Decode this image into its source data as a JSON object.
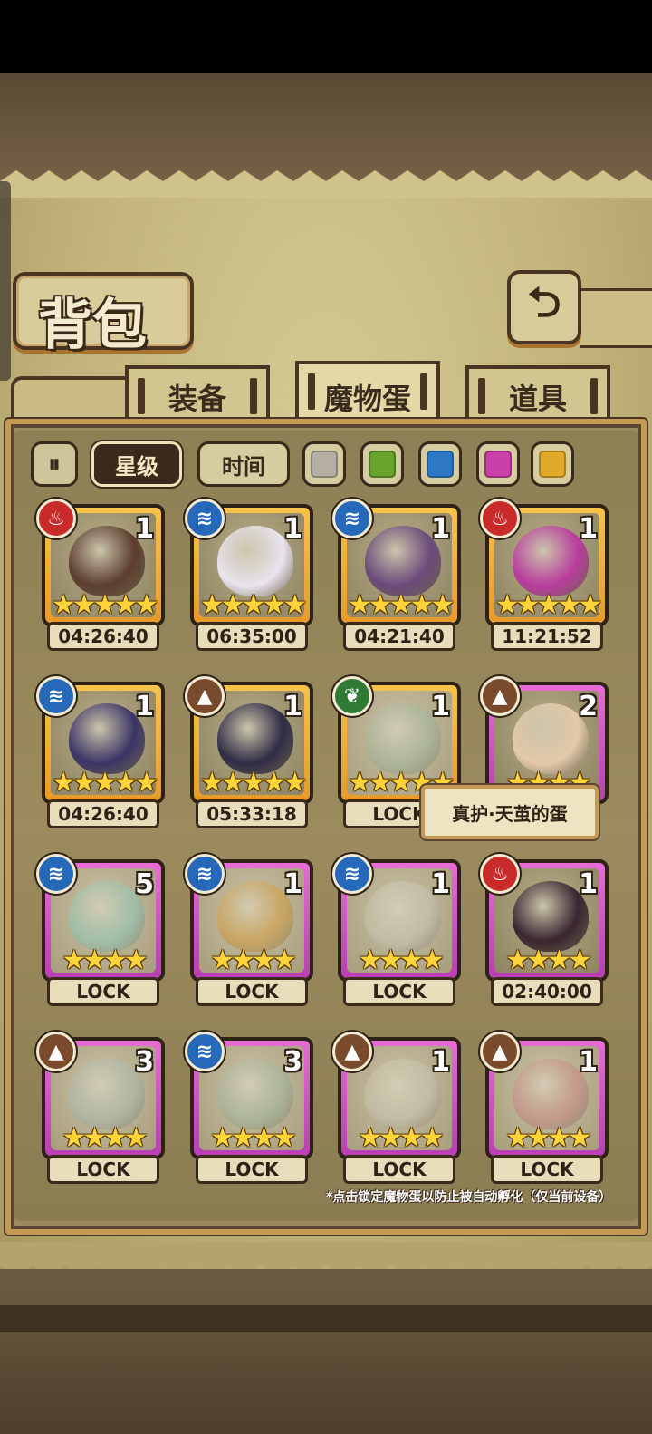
{
  "header": {
    "title": "背包",
    "back_icon": "return-icon"
  },
  "tabs": [
    {
      "label": "装备",
      "active": false
    },
    {
      "label": "魔物蛋",
      "active": true
    },
    {
      "label": "道具",
      "active": false
    }
  ],
  "filters": {
    "sort_icon": "pause-sort-icon",
    "star_label": "星级",
    "time_label": "时间",
    "swatches": [
      "#b5aea2",
      "#6aa22e",
      "#2f78c4",
      "#c840a8",
      "#e0a92a"
    ]
  },
  "eggs": [
    {
      "element": "fire",
      "count": "1",
      "stars": "★★★★★",
      "label": "04:26:40",
      "frame": "orange",
      "locked": false,
      "color": "#5c3e2e"
    },
    {
      "element": "water",
      "count": "1",
      "stars": "★★★★★",
      "label": "06:35:00",
      "frame": "orange",
      "locked": false,
      "color": "#e9e4ee"
    },
    {
      "element": "water",
      "count": "1",
      "stars": "★★★★★",
      "label": "04:21:40",
      "frame": "orange",
      "locked": false,
      "color": "#6b4a7a"
    },
    {
      "element": "fire",
      "count": "1",
      "stars": "★★★★★",
      "label": "11:21:52",
      "frame": "orange",
      "locked": false,
      "color": "#b93c9e"
    },
    {
      "element": "water",
      "count": "1",
      "stars": "★★★★★",
      "label": "04:26:40",
      "frame": "orange",
      "locked": false,
      "color": "#3b3567"
    },
    {
      "element": "earth",
      "count": "1",
      "stars": "★★★★★",
      "label": "05:33:18",
      "frame": "orange",
      "locked": false,
      "color": "#2f2c46"
    },
    {
      "element": "grass",
      "count": "1",
      "stars": "★★★★★",
      "label": "LOCK",
      "frame": "orange",
      "locked": true,
      "color": "#9fb59a"
    },
    {
      "element": "earth",
      "count": "2",
      "stars": "★★★★",
      "label": "",
      "frame": "pink",
      "locked": false,
      "color": "#e3c9a9"
    },
    {
      "element": "water",
      "count": "5",
      "stars": "★★★★",
      "label": "LOCK",
      "frame": "pink",
      "locked": true,
      "color": "#8ac7b8"
    },
    {
      "element": "water",
      "count": "1",
      "stars": "★★★★",
      "label": "LOCK",
      "frame": "pink",
      "locked": true,
      "color": "#d49a3a"
    },
    {
      "element": "water",
      "count": "1",
      "stars": "★★★★",
      "label": "LOCK",
      "frame": "pink",
      "locked": true,
      "color": "#c7c3b5"
    },
    {
      "element": "fire",
      "count": "1",
      "stars": "★★★★",
      "label": "02:40:00",
      "frame": "pink",
      "locked": false,
      "color": "#3a2630"
    },
    {
      "element": "earth",
      "count": "3",
      "stars": "★★★★",
      "label": "LOCK",
      "frame": "pink",
      "locked": true,
      "color": "#a7b9b0"
    },
    {
      "element": "water",
      "count": "3",
      "stars": "★★★★",
      "label": "LOCK",
      "frame": "pink",
      "locked": true,
      "color": "#9fb59a"
    },
    {
      "element": "earth",
      "count": "1",
      "stars": "★★★★",
      "label": "LOCK",
      "frame": "pink",
      "locked": true,
      "color": "#c9c3b0"
    },
    {
      "element": "earth",
      "count": "1",
      "stars": "★★★★",
      "label": "LOCK",
      "frame": "pink",
      "locked": true,
      "color": "#c98484"
    }
  ],
  "tooltip": {
    "text": "真护·天茧的蛋"
  },
  "footnote": "*点击锁定魔物蛋以防止被自动孵化（仅当前设备）"
}
